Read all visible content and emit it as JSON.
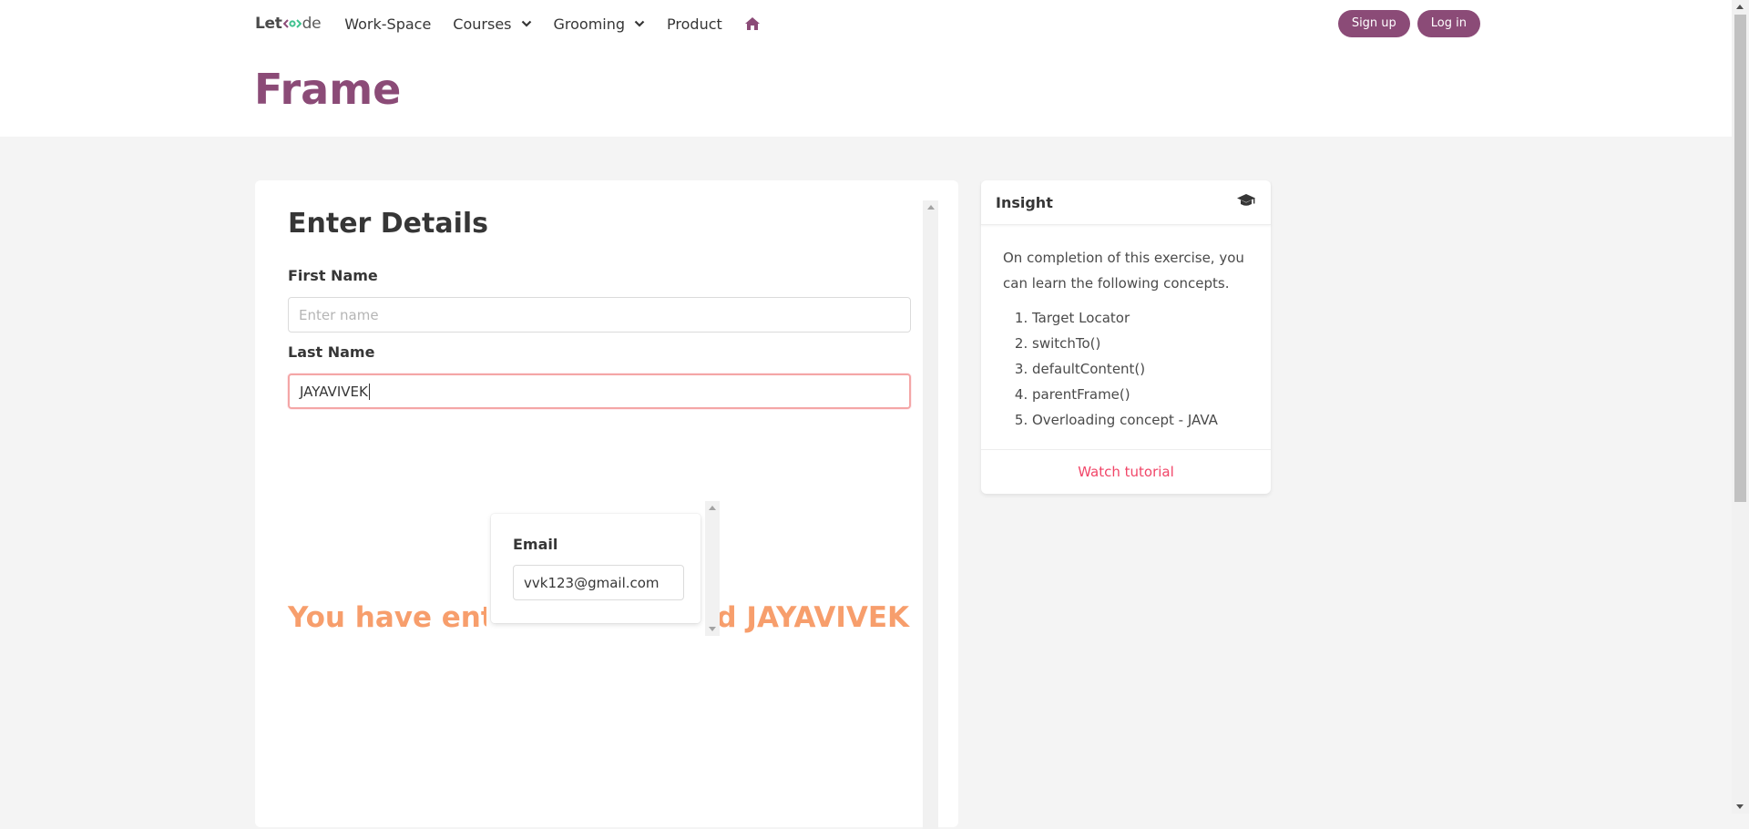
{
  "navbar": {
    "logo": {
      "part1": "Let",
      "part2": "de"
    },
    "items": [
      {
        "label": "Work-Space",
        "has_dropdown": false
      },
      {
        "label": "Courses",
        "has_dropdown": true
      },
      {
        "label": "Grooming",
        "has_dropdown": true
      },
      {
        "label": "Product",
        "has_dropdown": false
      }
    ],
    "home_icon": "home-icon",
    "signup_label": "Sign up",
    "login_label": "Log in"
  },
  "page": {
    "title": "Frame"
  },
  "form": {
    "heading": "Enter Details",
    "first_name_label": "First Name",
    "first_name_placeholder": "Enter name",
    "first_name_value": "",
    "last_name_label": "Last Name",
    "last_name_value": "JAYAVIVEK",
    "result_message": "You have entered undefined JAYAVIVEK"
  },
  "inner_frame": {
    "email_label": "Email",
    "email_value": "vvk123@gmail.com"
  },
  "insight": {
    "title": "Insight",
    "icon": "graduation-cap-icon",
    "intro": "On completion of this exercise, you can learn the following concepts.",
    "concepts": [
      "Target Locator",
      "switchTo()",
      "defaultContent()",
      "parentFrame()",
      "Overloading concept - JAVA"
    ],
    "footer_link": "Watch tutorial"
  },
  "colors": {
    "brand": "#8b4b77",
    "result_text": "#f79e6c",
    "link": "#f14668",
    "focus_border": "#f4a6a6",
    "background": "#f4f4f4"
  }
}
